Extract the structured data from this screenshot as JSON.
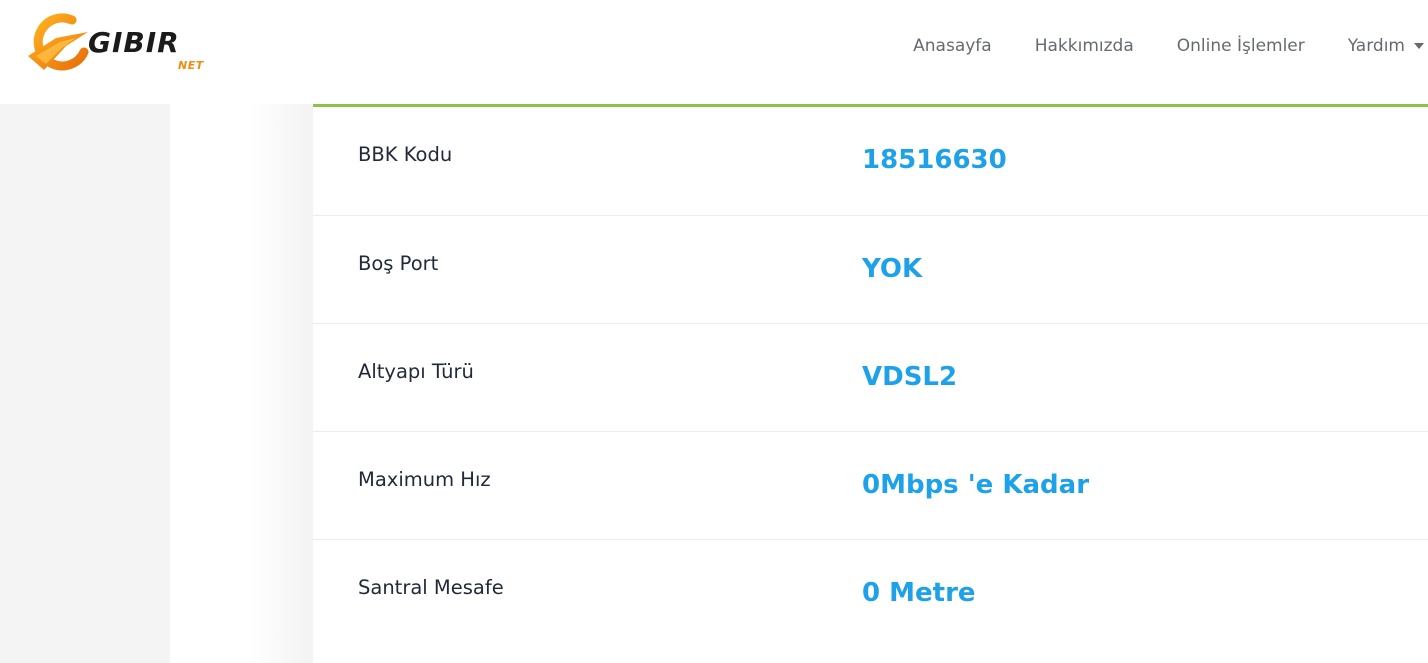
{
  "brand": {
    "name": "GIBIR",
    "sub": "NET",
    "accent_color": "#f08c10"
  },
  "nav": {
    "items": [
      {
        "label": "Anasayfa"
      },
      {
        "label": "Hakkımızda"
      },
      {
        "label": "Online İşlemler"
      },
      {
        "label": "Yardım"
      }
    ]
  },
  "details": {
    "rows": [
      {
        "label": "BBK Kodu",
        "value": "18516630"
      },
      {
        "label": "Boş Port",
        "value": "YOK"
      },
      {
        "label": "Altyapı Türü",
        "value": "VDSL2"
      },
      {
        "label": "Maximum Hız",
        "value": "0Mbps 'e Kadar"
      },
      {
        "label": "Santral Mesafe",
        "value": "0 Metre"
      }
    ]
  },
  "colors": {
    "value_text": "#1da1e8",
    "card_top_border": "#8bc34a",
    "label_text": "#222a3a",
    "nav_text": "#666a70"
  }
}
